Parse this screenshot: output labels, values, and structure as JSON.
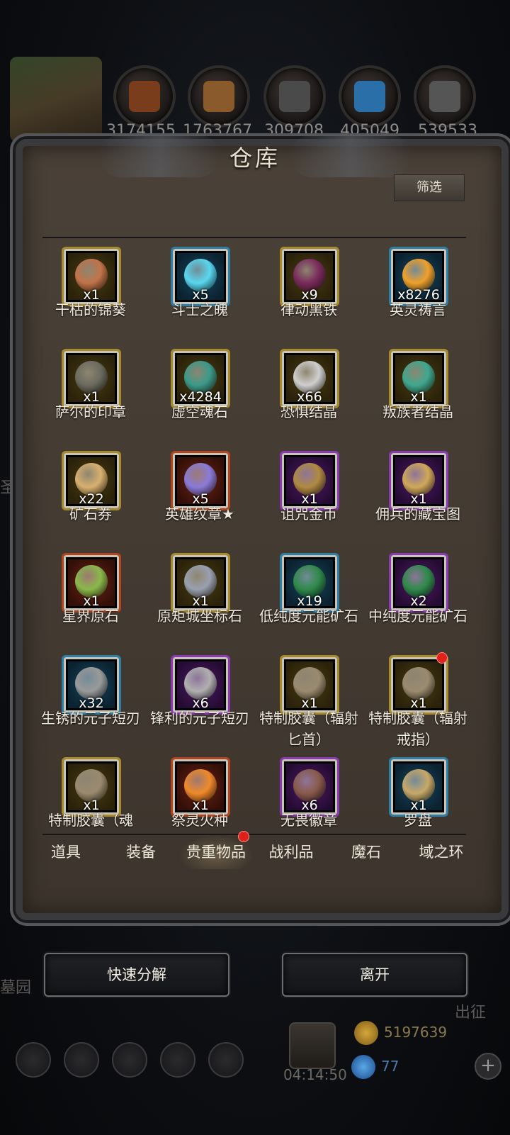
{
  "resources": {
    "values": [
      "3174155",
      "1763767",
      "309708",
      "405049",
      "539533"
    ],
    "icon_colors": [
      "#7a3d1c",
      "#8a5a2a",
      "#4a4a4a",
      "#2a6fa8",
      "#555555"
    ],
    "icons": [
      "meat-icon",
      "wood-icon",
      "iron-icon",
      "crystal-icon",
      "steel-icon"
    ]
  },
  "panel": {
    "title": "仓库",
    "filter_label": "筛选"
  },
  "items": [
    {
      "name": "干枯的锦葵",
      "qty": "x1",
      "frame": "gold",
      "color": "#c2734a"
    },
    {
      "name": "斗士之魄",
      "qty": "x5",
      "frame": "blue",
      "color": "#59d8f0"
    },
    {
      "name": "律动黑铁",
      "qty": "x9",
      "frame": "gold",
      "color": "#7a2a5c"
    },
    {
      "name": "英灵祷言",
      "qty": "x8276",
      "frame": "blue",
      "color": "#f0a02a"
    },
    {
      "name": "萨尔的印章",
      "qty": "x1",
      "frame": "gold",
      "color": "#6b6b60"
    },
    {
      "name": "虚空魂石",
      "qty": "x4284",
      "frame": "gold",
      "color": "#3b9a8a"
    },
    {
      "name": "恐惧结晶",
      "qty": "x66",
      "frame": "gold",
      "color": "#cfcfcf"
    },
    {
      "name": "叛族者结晶",
      "qty": "x1",
      "frame": "gold",
      "color": "#3fa88f"
    },
    {
      "name": "矿石券",
      "qty": "x22",
      "frame": "gold",
      "color": "#d8b070"
    },
    {
      "name": "英雄纹章★",
      "qty": "x5",
      "frame": "red",
      "color": "#8a7ad8"
    },
    {
      "name": "诅咒金币",
      "qty": "x1",
      "frame": "purple",
      "color": "#b08a40"
    },
    {
      "name": "佣兵的藏宝图",
      "qty": "x1",
      "frame": "purple",
      "color": "#d0a858"
    },
    {
      "name": "星界原石",
      "qty": "x1",
      "frame": "red",
      "color": "#8ab84a"
    },
    {
      "name": "原矩城坐标石",
      "qty": "x1",
      "frame": "gold",
      "color": "#9aa0b0"
    },
    {
      "name": "低纯度元能矿石",
      "qty": "x19",
      "frame": "blue",
      "color": "#2f8a4a"
    },
    {
      "name": "中纯度元能矿石",
      "qty": "x2",
      "frame": "purple",
      "color": "#2f8a4a"
    },
    {
      "name": "生锈的元子短刃",
      "qty": "x32",
      "frame": "blue",
      "color": "#9a9a9a"
    },
    {
      "name": "锋利的元子短刃",
      "qty": "x6",
      "frame": "purple",
      "color": "#b0b0b0"
    },
    {
      "name": "特制胶囊（辐射匕首）",
      "qty": "x1",
      "frame": "gold",
      "color": "#9a8a70"
    },
    {
      "name": "特制胶囊（辐射戒指）",
      "qty": "x1",
      "frame": "gold",
      "color": "#9a8a70",
      "badge": true
    },
    {
      "name": "特制胶囊（魂",
      "qty": "x1",
      "frame": "gold",
      "color": "#9a8a70"
    },
    {
      "name": "祭灵火种",
      "qty": "x1",
      "frame": "red",
      "color": "#f08a2a"
    },
    {
      "name": "无畏徽章",
      "qty": "x6",
      "frame": "purple",
      "color": "#8a5a4a"
    },
    {
      "name": "罗盘",
      "qty": "x1",
      "frame": "blue",
      "color": "#c8a868"
    }
  ],
  "tabs": [
    {
      "label": "道具"
    },
    {
      "label": "装备"
    },
    {
      "label": "贵重物品",
      "active": true,
      "badge": true
    },
    {
      "label": "战利品"
    },
    {
      "label": "魔石"
    },
    {
      "label": "域之环"
    }
  ],
  "actions": {
    "decompose_label": "快速分解",
    "leave_label": "离开"
  },
  "background": {
    "left_text_1": "圣途",
    "left_text_2": "墓园",
    "right_text": "出征",
    "timer": "04:14:50",
    "gold": "5197639",
    "gems": "77"
  }
}
